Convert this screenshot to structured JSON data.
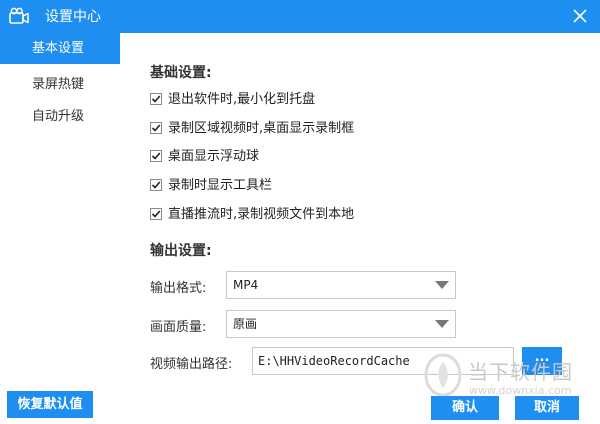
{
  "window": {
    "title": "设置中心",
    "accent_color": "#1e8ff0",
    "logo_icon": "camera-logo-icon",
    "close_icon": "close-icon"
  },
  "sidebar": {
    "items": [
      {
        "label": "基本设置",
        "active": true
      },
      {
        "label": "录屏热键",
        "active": false
      },
      {
        "label": "自动升级",
        "active": false
      }
    ]
  },
  "basic_settings": {
    "title": "基础设置:",
    "options": [
      {
        "label": "退出软件时,最小化到托盘",
        "checked": true
      },
      {
        "label": "录制区域视频时,桌面显示录制框",
        "checked": true
      },
      {
        "label": "桌面显示浮动球",
        "checked": true
      },
      {
        "label": "录制时显示工具栏",
        "checked": true
      },
      {
        "label": "直播推流时,录制视频文件到本地",
        "checked": true
      }
    ]
  },
  "output_settings": {
    "title": "输出设置:",
    "format_label": "输出格式:",
    "format_value": "MP4",
    "quality_label": "画面质量:",
    "quality_value": "原画",
    "path_label": "视频输出路径:",
    "path_value": "E:\\HHVideoRecordCache",
    "browse_label": "..."
  },
  "footer": {
    "restore_label": "恢复默认值",
    "ok_label": "确认",
    "cancel_label": "取消"
  },
  "watermark": {
    "text": "当下软件园",
    "sub": "www.downxia.com"
  }
}
